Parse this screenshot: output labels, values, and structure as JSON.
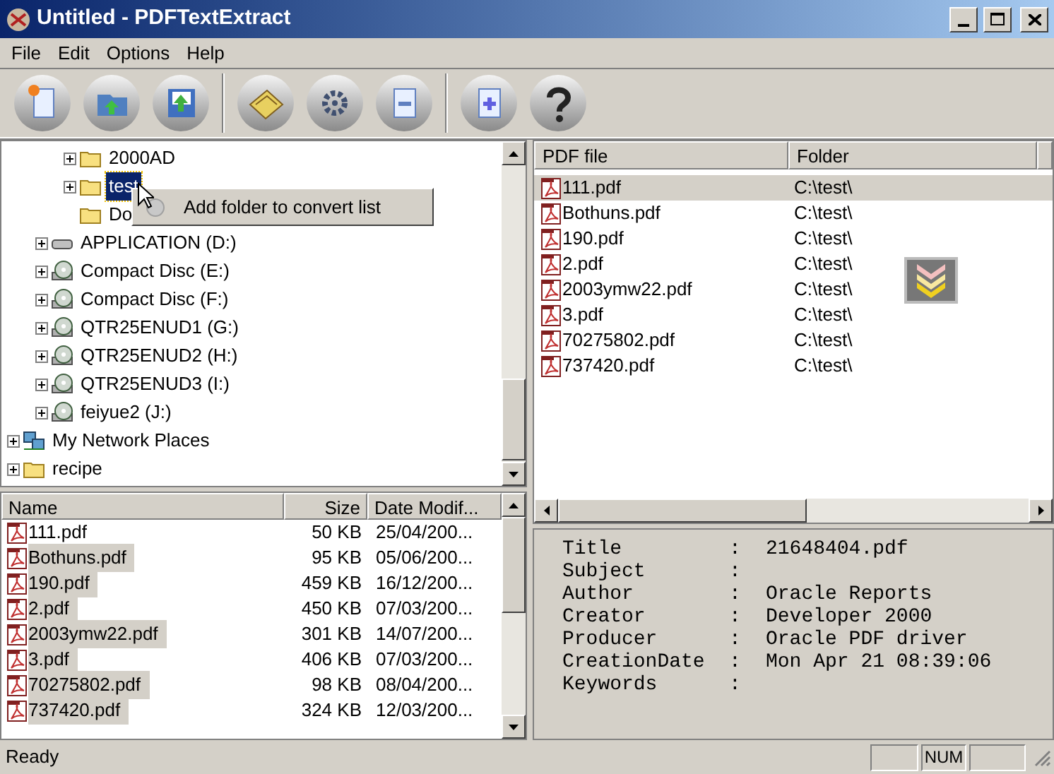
{
  "window": {
    "title": "Untitled - PDFTextExtract"
  },
  "menu": [
    "File",
    "Edit",
    "Options",
    "Help"
  ],
  "tree": {
    "items": [
      {
        "kind": "offscreen",
        "children": [
          {
            "kind": "offscreen",
            "children": [
              {
                "kind": "folder",
                "label": "2000AD",
                "expandable": true,
                "selected": false
              },
              {
                "kind": "folder",
                "label": "test",
                "expandable": true,
                "selected": true
              },
              {
                "kind": "folder",
                "label": "Do",
                "expandable": false,
                "selected": false
              }
            ]
          },
          {
            "kind": "drive",
            "label": "APPLICATION (D:)",
            "expandable": true,
            "selected": false
          },
          {
            "kind": "cd",
            "label": "Compact Disc (E:)",
            "expandable": true,
            "selected": false
          },
          {
            "kind": "cd",
            "label": "Compact Disc (F:)",
            "expandable": true,
            "selected": false
          },
          {
            "kind": "cd",
            "label": "QTR25ENUD1 (G:)",
            "expandable": true,
            "selected": false
          },
          {
            "kind": "cd",
            "label": "QTR25ENUD2 (H:)",
            "expandable": true,
            "selected": false
          },
          {
            "kind": "cd",
            "label": "QTR25ENUD3 (I:)",
            "expandable": true,
            "selected": false
          },
          {
            "kind": "cd",
            "label": "feiyue2 (J:)",
            "expandable": true,
            "selected": false
          }
        ]
      },
      {
        "kind": "network",
        "label": "My Network Places",
        "expandable": true,
        "selected": false
      },
      {
        "kind": "folder",
        "label": "recipe",
        "expandable": true,
        "selected": false
      }
    ]
  },
  "context_menu": {
    "items": [
      "Add folder to convert list"
    ]
  },
  "file_list": {
    "columns": [
      "Name",
      "Size",
      "Date Modif..."
    ],
    "rows": [
      {
        "name": "111.pdf",
        "size": "50 KB",
        "date": "25/04/200...",
        "selected": false
      },
      {
        "name": "Bothuns.pdf",
        "size": "95 KB",
        "date": "05/06/200...",
        "selected": true
      },
      {
        "name": "190.pdf",
        "size": "459 KB",
        "date": "16/12/200...",
        "selected": true
      },
      {
        "name": "2.pdf",
        "size": "450 KB",
        "date": "07/03/200...",
        "selected": true
      },
      {
        "name": "2003ymw22.pdf",
        "size": "301 KB",
        "date": "14/07/200...",
        "selected": true
      },
      {
        "name": "3.pdf",
        "size": "406 KB",
        "date": "07/03/200...",
        "selected": true
      },
      {
        "name": "70275802.pdf",
        "size": "98 KB",
        "date": "08/04/200...",
        "selected": true
      },
      {
        "name": "737420.pdf",
        "size": "324 KB",
        "date": "12/03/200...",
        "selected": true
      }
    ]
  },
  "convert_list": {
    "columns": [
      "PDF file",
      "Folder"
    ],
    "rows": [
      {
        "file": "111.pdf",
        "folder": "C:\\test\\",
        "selected": true
      },
      {
        "file": "Bothuns.pdf",
        "folder": "C:\\test\\",
        "selected": false
      },
      {
        "file": "190.pdf",
        "folder": "C:\\test\\",
        "selected": false
      },
      {
        "file": "2.pdf",
        "folder": "C:\\test\\",
        "selected": false
      },
      {
        "file": "2003ymw22.pdf",
        "folder": "C:\\test\\",
        "selected": false
      },
      {
        "file": "3.pdf",
        "folder": "C:\\test\\",
        "selected": false
      },
      {
        "file": "70275802.pdf",
        "folder": "C:\\test\\",
        "selected": false
      },
      {
        "file": "737420.pdf",
        "folder": "C:\\test\\",
        "selected": false
      }
    ]
  },
  "info": [
    {
      "label": "Title",
      "separator": ":",
      "value": "21648404.pdf"
    },
    {
      "label": "Subject",
      "separator": ":"
    },
    {
      "label": "Author",
      "separator": ":",
      "value": "Oracle Reports"
    },
    {
      "label": "Creator",
      "separator": ":",
      "value": "Developer 2000"
    },
    {
      "label": "Producer",
      "separator": ":",
      "value": "Oracle PDF driver"
    },
    {
      "label": "CreationDate",
      "separator": ":",
      "value": "Mon Apr 21 08:39:06"
    },
    {
      "label": "Keywords",
      "separator": ":"
    }
  ],
  "status_bar": {
    "text": "Ready",
    "indicators": [
      {
        "kind": "blank"
      },
      {
        "kind": "text",
        "label": "NUM"
      },
      {
        "kind": "blank"
      }
    ]
  }
}
